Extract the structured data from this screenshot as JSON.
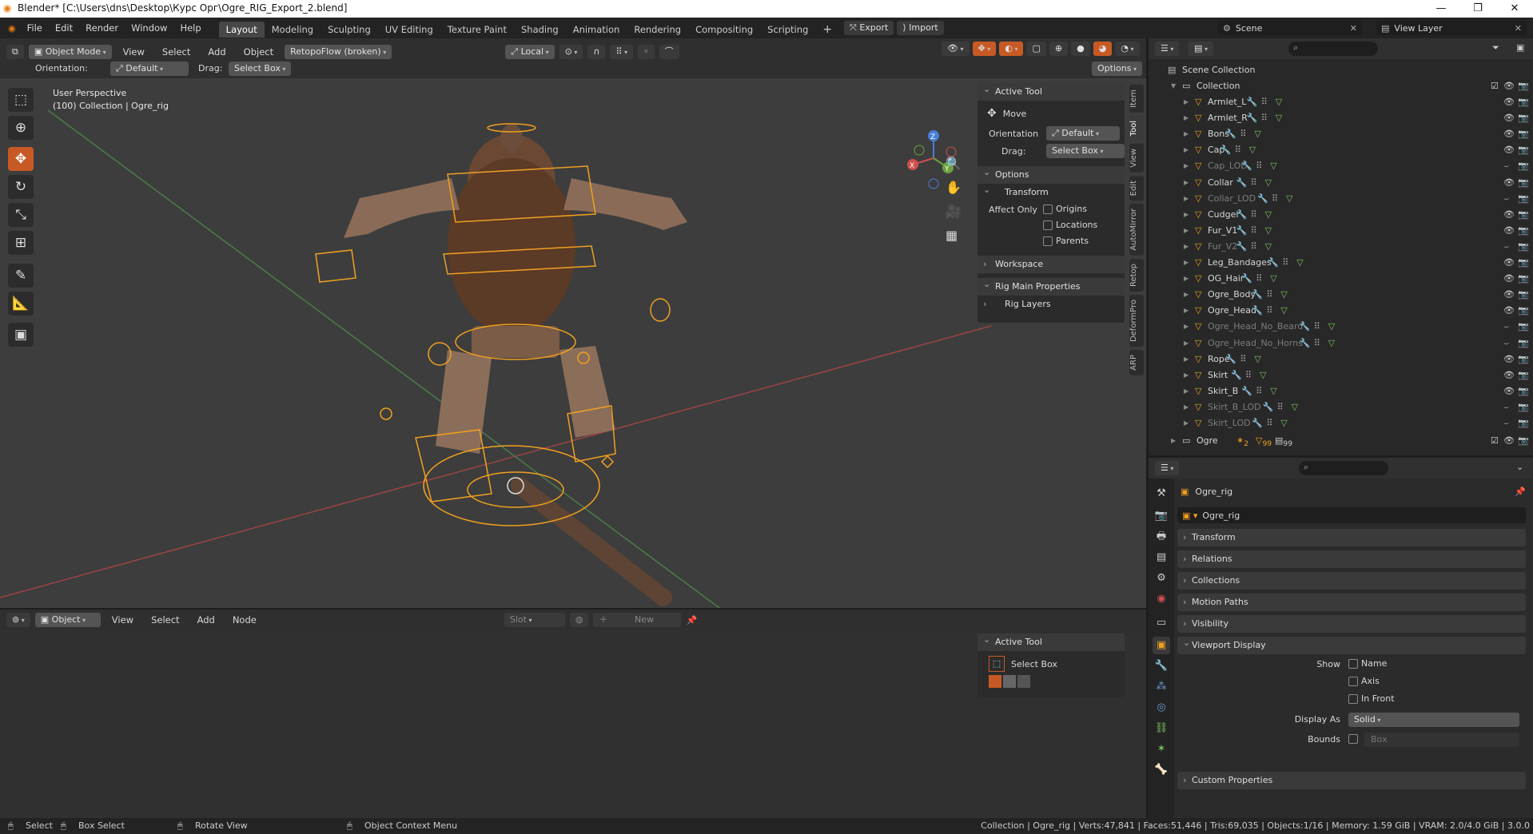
{
  "window": {
    "title": "Blender* [C:\\Users\\dns\\Desktop\\Курс Орг\\Ogre_RIG_Export_2.blend]",
    "minimize": "—",
    "maximize": "❐",
    "close": "✕"
  },
  "topbar": {
    "menus": [
      "File",
      "Edit",
      "Render",
      "Window",
      "Help"
    ],
    "workspaces": [
      "Layout",
      "Modeling",
      "Sculpting",
      "UV Editing",
      "Texture Paint",
      "Shading",
      "Animation",
      "Rendering",
      "Compositing",
      "Scripting"
    ],
    "active_workspace": "Layout",
    "add_tab": "+",
    "export_label": "Export",
    "import_label": "Import",
    "scene_label": "Scene",
    "view_layer_label": "View Layer"
  },
  "viewport": {
    "mode": "Object Mode",
    "menus": [
      "View",
      "Select",
      "Add",
      "Object"
    ],
    "addon_menu": "RetopoFlow (broken)",
    "transform_space": "Local",
    "orientation_label": "Orientation:",
    "orientation_value": "Default",
    "drag_label": "Drag:",
    "drag_value": "Select Box",
    "options_label": "Options",
    "info_line1": "User Perspective",
    "info_line2": "(100) Collection | Ogre_rig",
    "gizmo_axes": [
      "Z",
      "Y",
      "X"
    ]
  },
  "npanel": {
    "active_tool_header": "Active Tool",
    "tool_name": "Move",
    "orientation_label": "Orientation",
    "orientation_value": "Default",
    "drag_label": "Drag:",
    "drag_value": "Select Box",
    "options_header": "Options",
    "transform_header": "Transform",
    "affect_only_label": "Affect Only",
    "affect_items": [
      "Origins",
      "Locations",
      "Parents"
    ],
    "workspace_header": "Workspace",
    "rig_main_header": "Rig Main Properties",
    "rig_layers_label": "Rig Layers",
    "tabs": [
      "Item",
      "Tool",
      "View",
      "Edit",
      "AutoMirror",
      "Retop",
      "DeformPro",
      "ARP"
    ],
    "active_tab": "Tool"
  },
  "outliner": {
    "scene_collection": "Scene Collection",
    "collection": "Collection",
    "items": [
      {
        "name": "Armlet_L",
        "dim": false
      },
      {
        "name": "Armlet_R",
        "dim": false
      },
      {
        "name": "Bons",
        "dim": false
      },
      {
        "name": "Cap",
        "dim": false
      },
      {
        "name": "Cap_LOD",
        "dim": true
      },
      {
        "name": "Collar",
        "dim": false
      },
      {
        "name": "Collar_LOD",
        "dim": true
      },
      {
        "name": "Cudgel",
        "dim": false
      },
      {
        "name": "Fur_V1",
        "dim": false
      },
      {
        "name": "Fur_V2",
        "dim": true
      },
      {
        "name": "Leg_Bandages",
        "dim": false
      },
      {
        "name": "OG_Hair",
        "dim": false
      },
      {
        "name": "Ogre_Body",
        "dim": false
      },
      {
        "name": "Ogre_Head",
        "dim": false
      },
      {
        "name": "Ogre_Head_No_Beard",
        "dim": true
      },
      {
        "name": "Ogre_Head_No_Horns",
        "dim": true
      },
      {
        "name": "Rope",
        "dim": false
      },
      {
        "name": "Skirt",
        "dim": false
      },
      {
        "name": "Skirt_B",
        "dim": false
      },
      {
        "name": "Skirt_B_LOD",
        "dim": true
      },
      {
        "name": "Skirt_LOD",
        "dim": true
      }
    ],
    "ogre_collection": "Ogre",
    "ogre_badges": [
      "2",
      "99",
      "99"
    ]
  },
  "properties": {
    "object_name": "Ogre_rig",
    "datablock_name": "Ogre_rig",
    "sections": [
      "Transform",
      "Relations",
      "Collections",
      "Motion Paths",
      "Visibility"
    ],
    "viewport_display": "Viewport Display",
    "show_label": "Show",
    "show_items": [
      "Name",
      "Axis",
      "In Front"
    ],
    "display_as_label": "Display As",
    "display_as_value": "Solid",
    "bounds_label": "Bounds",
    "bounds_value": "Box",
    "custom_props": "Custom Properties"
  },
  "bottom_editor": {
    "mode": "Object",
    "menus": [
      "View",
      "Select",
      "Add",
      "Node"
    ],
    "slot_label": "Slot",
    "new_label": "New",
    "active_tool_header": "Active Tool",
    "tool_name": "Select Box"
  },
  "statusbar": {
    "select": "Select",
    "box_select": "Box Select",
    "rotate_view": "Rotate View",
    "context_menu": "Object Context Menu",
    "stats": "Collection | Ogre_rig | Verts:47,841 | Faces:51,446 | Tris:69,035 | Objects:1/16 | Memory: 1.59 GiB | VRAM: 2.0/4.0 GiB | 3.0.0"
  },
  "colors": {
    "accent": "#c75a24",
    "rig": "#f0a020",
    "xaxis": "#b84a4a",
    "yaxis": "#4d8f4d"
  }
}
